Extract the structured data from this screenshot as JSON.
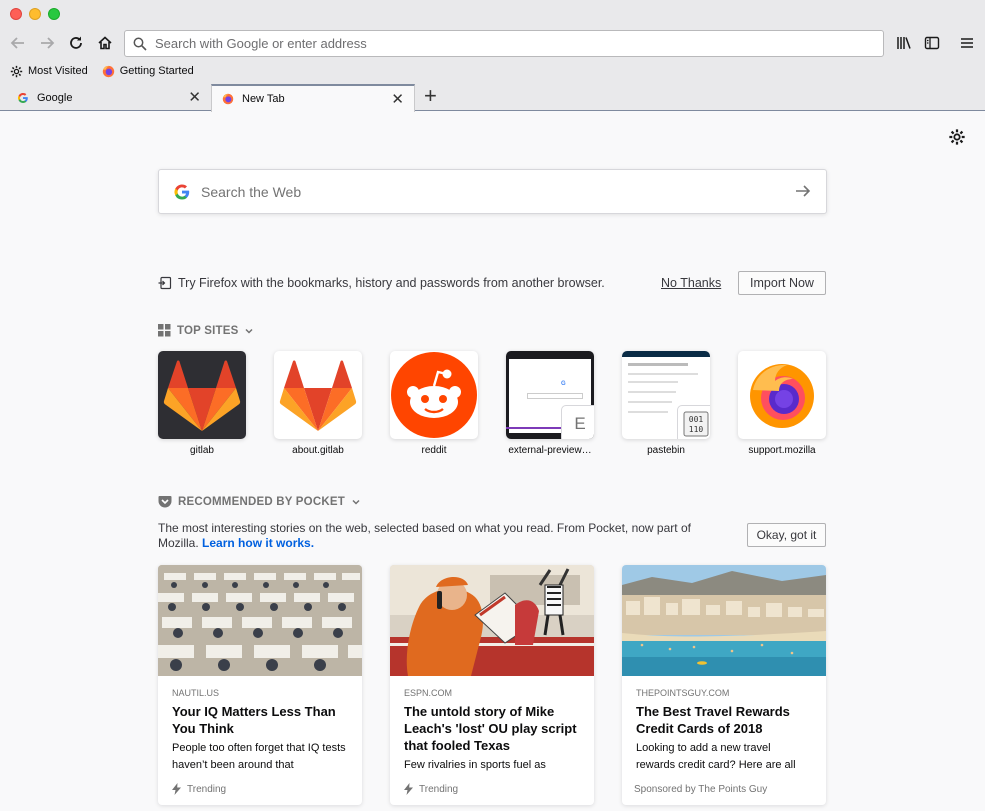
{
  "browser": {
    "urlbar_placeholder": "Search with Google or enter address",
    "bookmarks": [
      {
        "label": "Most Visited",
        "icon": "gear-icon"
      },
      {
        "label": "Getting Started",
        "icon": "firefox-icon"
      }
    ],
    "tabs": [
      {
        "label": "Google",
        "icon": "google-icon",
        "active": false
      },
      {
        "label": "New Tab",
        "icon": "firefox-icon",
        "active": true
      }
    ]
  },
  "search": {
    "placeholder": "Search the Web"
  },
  "import": {
    "message": "Try Firefox with the bookmarks, history and passwords from another browser.",
    "no_thanks": "No Thanks",
    "import_now": "Import Now"
  },
  "top_sites": {
    "title": "TOP SITES",
    "sites": [
      {
        "name": "gitlab"
      },
      {
        "name": "about.gitlab"
      },
      {
        "name": "reddit"
      },
      {
        "name": "external-preview…",
        "badge": "E"
      },
      {
        "name": "pastebin"
      },
      {
        "name": "support.mozilla"
      }
    ]
  },
  "pocket": {
    "title": "RECOMMENDED BY POCKET",
    "description": "The most interesting stories on the web, selected based on what you read. From Pocket, now part of Mozilla.",
    "learn_more": "Learn how it works.",
    "okay": "Okay, got it",
    "cards": [
      {
        "source": "NAUTIL.US",
        "title": "Your IQ Matters Less Than You Think",
        "excerpt": "People too often forget that IQ tests haven’t been around that",
        "context": "Trending"
      },
      {
        "source": "ESPN.COM",
        "title": "The untold story of Mike Leach's 'lost' OU play script that fooled Texas",
        "excerpt": "Few rivalries in sports fuel as",
        "context": "Trending"
      },
      {
        "source": "THEPOINTSGUY.COM",
        "title": "The Best Travel Rewards Credit Cards of 2018",
        "excerpt": "Looking to add a new travel rewards credit card? Here are all",
        "context": "Sponsored by The Points Guy"
      }
    ]
  },
  "colors": {
    "accent": "#0060df",
    "chrome": "#e9e9eb",
    "page": "#f9f9fa"
  }
}
